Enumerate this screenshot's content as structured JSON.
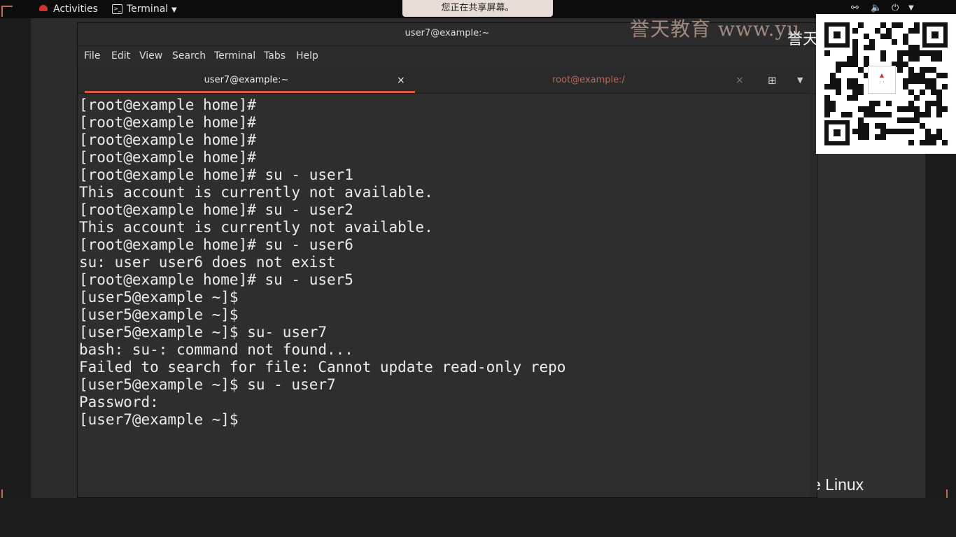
{
  "topbar": {
    "activities": "Activities",
    "app_menu": "Terminal",
    "share_notice": "您正在共享屏幕。"
  },
  "window": {
    "title": "user7@example:~",
    "menu": [
      "File",
      "Edit",
      "View",
      "Search",
      "Terminal",
      "Tabs",
      "Help"
    ],
    "tabs": [
      {
        "label": "user7@example:~",
        "active": true
      },
      {
        "label": "root@example:/",
        "active": false
      }
    ]
  },
  "terminal": {
    "lines": [
      "[root@example home]#",
      "[root@example home]#",
      "[root@example home]#",
      "[root@example home]#",
      "[root@example home]# su - user1",
      "This account is currently not available.",
      "[root@example home]# su - user2",
      "This account is currently not available.",
      "[root@example home]# su - user6",
      "su: user user6 does not exist",
      "[root@example home]# su - user5",
      "[user5@example ~]$",
      "[user5@example ~]$",
      "[user5@example ~]$ su- user7",
      "bash: su-: command not found...",
      "Failed to search for file: Cannot update read-only repo",
      "[user5@example ~]$ su - user7",
      "Password:",
      "[user7@example ~]$"
    ]
  },
  "watermark": {
    "text": "誉天教育 www.yu",
    "partial": "誉天"
  },
  "background_brand": "e Linux",
  "colors": {
    "accent": "#e0573d",
    "terminal_bg": "#2e2e2e",
    "terminal_fg": "#ececec"
  }
}
